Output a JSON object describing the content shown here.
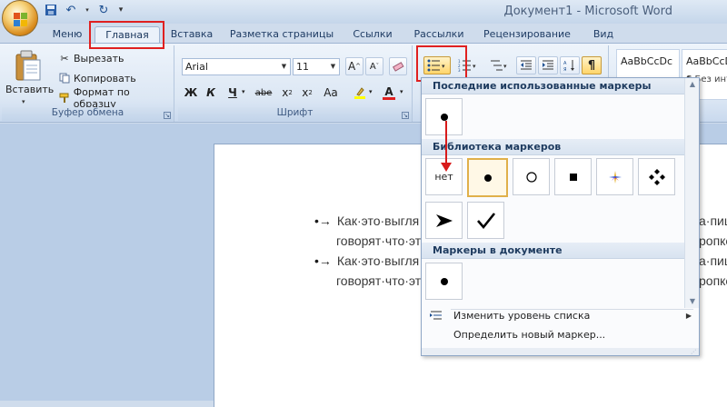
{
  "window": {
    "title": "Документ1 - Microsoft Word"
  },
  "qat": {
    "icons": [
      "save-icon",
      "undo-icon",
      "redo-icon",
      "customize-icon"
    ]
  },
  "tabs": [
    {
      "label": "Меню"
    },
    {
      "label": "Главная",
      "active": true
    },
    {
      "label": "Вставка"
    },
    {
      "label": "Разметка страницы"
    },
    {
      "label": "Ссылки"
    },
    {
      "label": "Рассылки"
    },
    {
      "label": "Рецензирование"
    },
    {
      "label": "Вид"
    }
  ],
  "clipboard": {
    "paste_label": "Вставить",
    "cut_label": "Вырезать",
    "copy_label": "Копировать",
    "format_painter_label": "Формат по образцу",
    "group_label": "Буфер обмена"
  },
  "font": {
    "font_name": "Arial",
    "font_size": "11",
    "group_label": "Шрифт",
    "buttons": [
      "Ж",
      "К",
      "Ч",
      "abe",
      "x",
      "x",
      "Aa",
      "A"
    ]
  },
  "styles": {
    "tiles": [
      {
        "preview": "AaBbCcDc",
        "name": ""
      },
      {
        "preview": "AaBbCcDc",
        "name": "¶ Без инт"
      }
    ]
  },
  "document": {
    "lines": [
      {
        "text": "Как·это·выгля",
        "bullet": true
      },
      {
        "text": "говорят·что·эт",
        "bullet": false
      },
      {
        "text": "Как·это·выгля",
        "bullet": true
      },
      {
        "text": "говорят·что·эт",
        "bullet": false
      }
    ],
    "right_fragments": [
      "а·пиш",
      "ропке",
      "а·пиш",
      "ропке"
    ]
  },
  "bullet_menu": {
    "recent_header": "Последние использованные маркеры",
    "library_header": "Библиотека маркеров",
    "document_header": "Маркеры в документе",
    "none_label": "нет",
    "change_level_label": "Изменить уровень списка",
    "define_new_label": "Определить новый маркер..."
  }
}
